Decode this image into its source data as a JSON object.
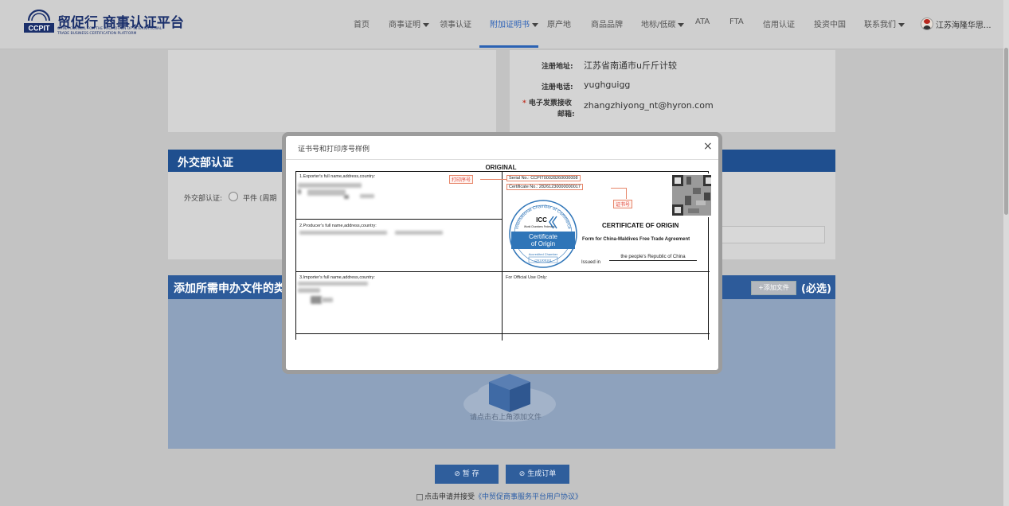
{
  "header": {
    "logo_cn": "贸促行 商事认证平台",
    "logo_en_1": "CHINA COUNCIL FOR THE PROMOTION OF INTERNATIONAL",
    "logo_en_2": "TRADE BUSINESS CERTIFICATION PLATFORM",
    "logo_mark": "CCPIT",
    "nav": [
      {
        "label": "首页"
      },
      {
        "label": "商事证明"
      },
      {
        "label": "领事认证"
      },
      {
        "label": "附加证明书"
      },
      {
        "label": "原产地"
      },
      {
        "label": "商品品牌"
      },
      {
        "label": "地标/低碳"
      },
      {
        "label": "ATA"
      },
      {
        "label": "FTA"
      },
      {
        "label": "信用认证"
      },
      {
        "label": "投资中国"
      },
      {
        "label": "联系我们"
      }
    ],
    "user_name": "江苏海隆华思...",
    "active_nav_color": "#2e63b8"
  },
  "background": {
    "reg_address_label": "注册地址:",
    "reg_address_value": "江苏省南通市u斤斤计较",
    "reg_phone_label": "注册电话:",
    "reg_phone_value": "yughguigg",
    "email_label_1": "电子发票接收",
    "email_label_2": "邮箱:",
    "email_value": "zhangzhiyong_nt@hyron.com",
    "mfa_title": "外交部认证",
    "mfa_field_label": "外交部认证:",
    "mfa_option": "平件 (周期",
    "docs_title": "添加所需申办文件的类",
    "add_file_button": "+添加文件",
    "required_tag": "(必选)",
    "upload_hint": "请点击右上角添加文件",
    "save_button": "暂 存",
    "generate_button": "生成订单",
    "agree_prefix": "点击申请并接受",
    "agree_link": "《中贸促商事服务平台用户协议》"
  },
  "modal": {
    "title": "证书号和打印序号样例",
    "close": "×",
    "certificate": {
      "heading": "ORIGINAL",
      "exporter_label": "1.Exporter's full name,address,country:",
      "producer_label": "2.Producer's full name,address,country:",
      "importer_label": "3.Importer's full name,address,country:",
      "official_use_label": "For Official Use Only:",
      "print_serial_stamp": "打印序号",
      "serial_no": "Serial No.:      CCPIT00028260000008",
      "certificate_no": "Certificate No.: 28261230000000017",
      "cert_no_stamp": "证书号",
      "seal_arc": "International Chamber of Commerce",
      "seal_icc": "ICC",
      "seal_wcf": "World Chambers Federation",
      "seal_cert_1": "Certificate",
      "seal_cert_2": "of Origin",
      "seal_accredited": "Accredited Chamber",
      "seal_code": "CN1306101",
      "coo_title": "CERTIFICATE OF ORIGIN",
      "coo_subtitle": "Form for China-Maldives Free Trade Agreement",
      "issued_in_label": "Issued in",
      "issued_in_value": "the people's Republic of China"
    }
  }
}
